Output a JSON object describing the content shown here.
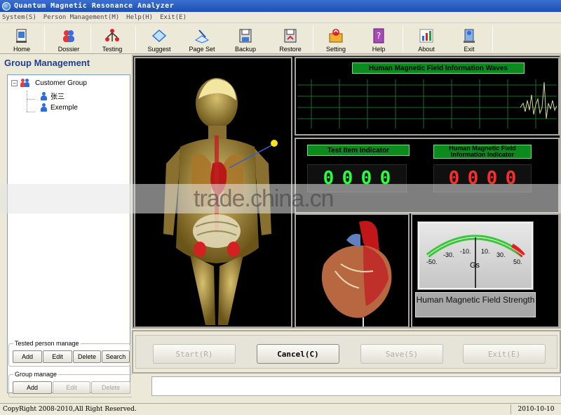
{
  "window": {
    "title": "Quantum Magnetic Resonance Analyzer"
  },
  "menu": [
    {
      "label": "System(S)"
    },
    {
      "label": "Person Management(M)"
    },
    {
      "label": "Help(H)"
    },
    {
      "label": "Exit(E)"
    }
  ],
  "toolbar": [
    {
      "label": "Home",
      "icon": "home-icon"
    },
    {
      "label": "Dossier",
      "icon": "dossier-icon"
    },
    {
      "label": "Testing",
      "icon": "testing-icon"
    },
    {
      "label": "Suggest",
      "icon": "suggest-icon"
    },
    {
      "label": "Page Set",
      "icon": "page-set-icon"
    },
    {
      "label": "Backup",
      "icon": "backup-icon"
    },
    {
      "label": "Restore",
      "icon": "restore-icon"
    },
    {
      "label": "Setting",
      "icon": "setting-icon"
    },
    {
      "label": "Help",
      "icon": "help-icon"
    },
    {
      "label": "About",
      "icon": "about-icon"
    },
    {
      "label": "Exit",
      "icon": "exit-icon"
    }
  ],
  "sidebar": {
    "title": "Group Management",
    "tree": {
      "root": {
        "label": "Customer Group",
        "expander": "−"
      },
      "children": [
        {
          "label": "张三"
        },
        {
          "label": "Exemple"
        }
      ]
    },
    "tested_group": {
      "legend": "Tested person manage",
      "buttons": [
        {
          "label": "Add"
        },
        {
          "label": "Edit"
        },
        {
          "label": "Delete"
        },
        {
          "label": "Search"
        }
      ]
    },
    "group_manage": {
      "legend": "Group manage",
      "buttons": [
        {
          "label": "Add"
        },
        {
          "label": "Edit"
        },
        {
          "label": "Delete"
        }
      ]
    }
  },
  "panels": {
    "waves_label": "Human Magnetic Field Information Waves",
    "test_item_label": "Test Item Indicator",
    "field_info_label": "Human Magnetic Field Information Indicator",
    "test_item_digits": [
      "0",
      "0",
      "0",
      "0"
    ],
    "field_info_digits": [
      "0",
      "0",
      "0",
      "0"
    ],
    "gauge": {
      "ticks": [
        "-50.",
        "-30.",
        "-10.",
        "10.",
        "30.",
        "50."
      ],
      "unit": "Gs",
      "caption": "Human Magnetic Field Strength"
    }
  },
  "actions": [
    {
      "label": "Start(R)",
      "enabled": false
    },
    {
      "label": "Cancel(C)",
      "enabled": true
    },
    {
      "label": "Save(S)",
      "enabled": false
    },
    {
      "label": "Exit(E)",
      "enabled": false
    }
  ],
  "status": {
    "copyright": "CopyRight 2008-2010,All Right Reserved.",
    "date": "2010-10-10"
  },
  "watermark": "trade.china.cn",
  "colors": {
    "title_bar": "#1e4fb4",
    "indicator_green": "#0c8a1e",
    "digit_green": "#27ff3a",
    "digit_red": "#ff2a2a",
    "sidebar_title": "#1e3f8c"
  }
}
